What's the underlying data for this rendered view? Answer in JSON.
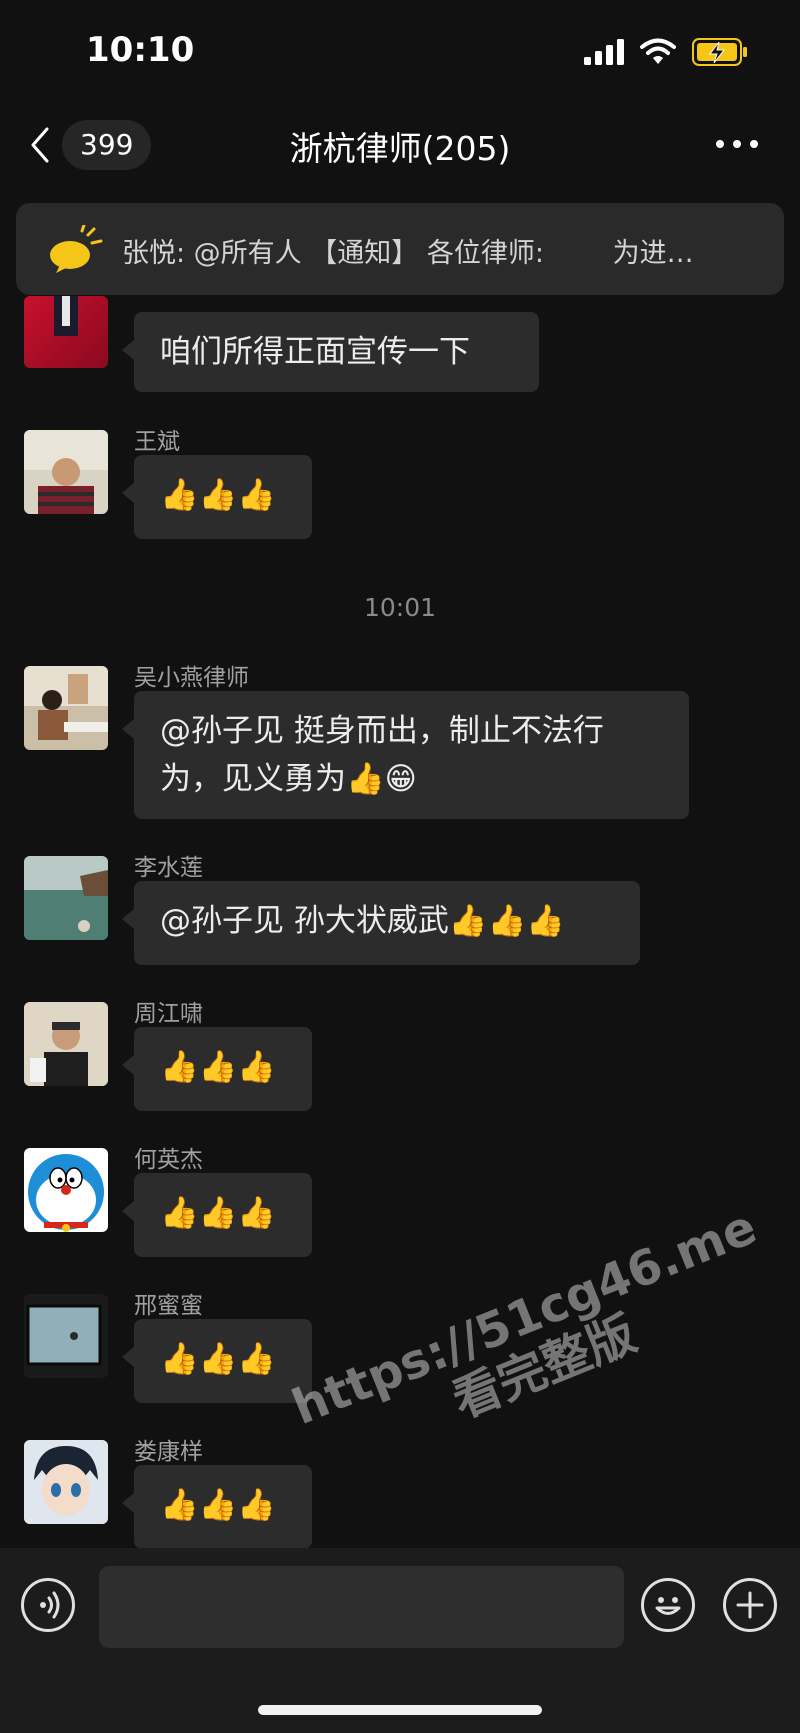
{
  "status": {
    "time": "10:10"
  },
  "nav": {
    "unread_count": "399",
    "title": "浙杭律师(205)"
  },
  "notice": {
    "text": "张悦: @所有人 【通知】 各位律师:        为进…"
  },
  "messages": [
    {
      "sender": "",
      "text": "咱们所得正面宣传一下"
    },
    {
      "sender": "王斌",
      "text": "👍👍👍"
    },
    {
      "sender": "吴小燕律师",
      "line1": "@孙子见 挺身而出，制止不法行",
      "line2": "为，见义勇为👍😁"
    },
    {
      "sender": "李水莲",
      "text": "@孙子见 孙大状威武👍👍👍"
    },
    {
      "sender": "周江啸",
      "text": "👍👍👍"
    },
    {
      "sender": "何英杰",
      "text": "👍👍👍"
    },
    {
      "sender": "邢蜜蜜",
      "text": "👍👍👍"
    },
    {
      "sender": "娄康样",
      "text": "👍👍👍"
    }
  ],
  "time_separator": "10:01",
  "watermark": {
    "line1": "https://51cg46.me",
    "line2": "看完整版"
  },
  "colors": {
    "background": "#111111",
    "bubble": "#2c2c2c",
    "accent_yellow": "#f5c518"
  }
}
